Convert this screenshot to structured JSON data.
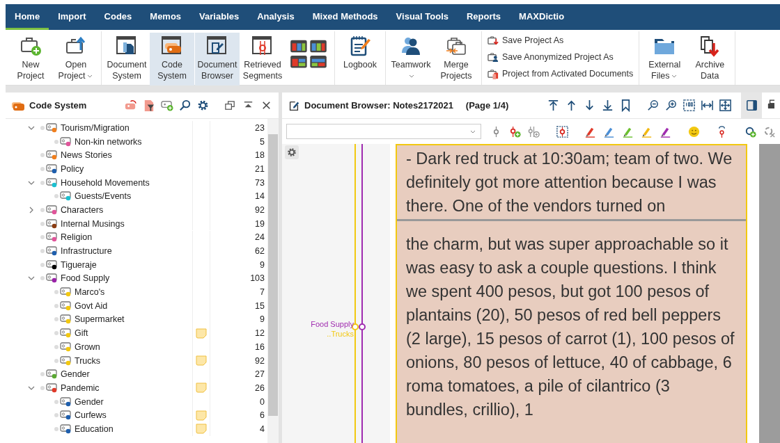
{
  "menu": {
    "tabs": [
      {
        "label": "Home",
        "selected": true
      },
      {
        "label": "Import",
        "selected": false
      },
      {
        "label": "Codes",
        "selected": false
      },
      {
        "label": "Memos",
        "selected": false
      },
      {
        "label": "Variables",
        "selected": false
      },
      {
        "label": "Analysis",
        "selected": false
      },
      {
        "label": "Mixed Methods",
        "selected": false
      },
      {
        "label": "Visual Tools",
        "selected": false
      },
      {
        "label": "Reports",
        "selected": false
      },
      {
        "label": "MAXDictio",
        "selected": false
      }
    ]
  },
  "ribbon": {
    "groups": [
      {
        "buttons": [
          {
            "kind": "large",
            "label": "New Project",
            "selected": false,
            "dropdown": false
          },
          {
            "kind": "large",
            "label": "Open Project",
            "selected": false,
            "dropdown": true
          }
        ]
      },
      {
        "buttons": [
          {
            "kind": "large",
            "label": "Document System",
            "selected": false,
            "dropdown": false
          },
          {
            "kind": "large",
            "label": "Code System",
            "selected": true,
            "dropdown": false
          },
          {
            "kind": "large",
            "label": "Document Browser",
            "selected": true,
            "dropdown": false
          },
          {
            "kind": "large",
            "label": "Retrieved Segments",
            "selected": false,
            "dropdown": false
          },
          {
            "kind": "layouts",
            "selected": false
          }
        ]
      },
      {
        "buttons": [
          {
            "kind": "large",
            "label": "Logbook",
            "selected": false,
            "dropdown": false
          }
        ]
      },
      {
        "buttons": [
          {
            "kind": "large",
            "label": "Teamwork",
            "selected": false,
            "dropdown": true
          },
          {
            "kind": "large",
            "label": "Merge Projects",
            "selected": false,
            "dropdown": false
          }
        ]
      },
      {
        "buttons": [
          {
            "kind": "small",
            "label": "Save Project As",
            "selected": false
          },
          {
            "kind": "small",
            "label": "Save Anonymized Project As",
            "selected": false
          },
          {
            "kind": "small",
            "label": "Project from Activated Documents",
            "selected": false
          }
        ]
      },
      {
        "buttons": [
          {
            "kind": "large",
            "label": "External Files",
            "selected": false,
            "dropdown": true
          },
          {
            "kind": "large",
            "label": "Archive Data",
            "selected": false,
            "dropdown": false
          }
        ]
      }
    ]
  },
  "code_system": {
    "title": "Code System",
    "items": [
      {
        "name": "Tourism/Migration",
        "count": "23",
        "color": "#f07f1e",
        "memo": false,
        "expanded": true,
        "children": [
          {
            "name": "Non-kin networks",
            "count": "5",
            "color": "#e0559a",
            "memo": false
          }
        ]
      },
      {
        "name": "News Stories",
        "count": "18",
        "color": "#f07f1e",
        "memo": false
      },
      {
        "name": "Policy",
        "count": "21",
        "color": "#1f5fad",
        "memo": false
      },
      {
        "name": "Household Movements",
        "count": "73",
        "color": "#1cc0d0",
        "memo": false,
        "expanded": true,
        "children": [
          {
            "name": "Guests/Events",
            "count": "14",
            "color": "#1cc0d0",
            "memo": false
          }
        ]
      },
      {
        "name": "Characters",
        "count": "92",
        "color": "#e0559a",
        "memo": false,
        "expanded": false
      },
      {
        "name": "Internal Musings",
        "count": "19",
        "color": "#8a3c12",
        "memo": false
      },
      {
        "name": "Religion",
        "count": "24",
        "color": "#e0559a",
        "memo": false
      },
      {
        "name": "Infrastructure",
        "count": "62",
        "color": "#1f5fad",
        "memo": false
      },
      {
        "name": "Tigueraje",
        "count": "9",
        "color": "#000000",
        "memo": false
      },
      {
        "name": "Food Supply",
        "count": "103",
        "color": "#9a22a8",
        "memo": false,
        "expanded": true,
        "children": [
          {
            "name": "Marco's",
            "count": "7",
            "color": "#f2c811",
            "memo": false
          },
          {
            "name": "Govt Aid",
            "count": "15",
            "color": "#f2c811",
            "memo": false
          },
          {
            "name": "Supermarket",
            "count": "9",
            "color": "#f2c811",
            "memo": false
          },
          {
            "name": "Gift",
            "count": "12",
            "color": "#f2c811",
            "memo": true
          },
          {
            "name": "Grown",
            "count": "16",
            "color": "#f2c811",
            "memo": false
          },
          {
            "name": "Trucks",
            "count": "92",
            "color": "#f2c811",
            "memo": true
          }
        ]
      },
      {
        "name": "Gender",
        "count": "27",
        "color": "#5aa832",
        "memo": false
      },
      {
        "name": "Pandemic",
        "count": "26",
        "color": "#e03a2a",
        "memo": true,
        "expanded": true,
        "children": [
          {
            "name": "Gender",
            "count": "0",
            "color": "#1f5fad",
            "memo": false
          },
          {
            "name": "Curfews",
            "count": "6",
            "color": "#1f5fad",
            "memo": true
          },
          {
            "name": "Education",
            "count": "4",
            "color": "#1f5fad",
            "memo": true
          }
        ]
      }
    ]
  },
  "document_browser": {
    "title": "Document Browser: Notes2172021",
    "page": "(Page 1/4)",
    "codings": [
      {
        "label": "Food Supply",
        "color": "#a02cb0"
      },
      {
        "label": "..Trucks",
        "color": "#f2c811"
      }
    ],
    "pages": [
      "- Dark red truck at 10:30am; team of two. We definitely got more attention because I was there. One of the vendors turned on",
      "the charm, but was super approachable so it was easy to ask a couple questions. I think we spent 400 pesos, but got 100 pesos of plantains (20), 50 pesos of red bell peppers (2 large), 15 pesos of carrot (1), 100 pesos of onions, 80 pesos of lettuce, 40 of cabbage, 6 roma tomatoes, a pile of cilantrico (3 bundles, crillio), 1"
    ]
  }
}
